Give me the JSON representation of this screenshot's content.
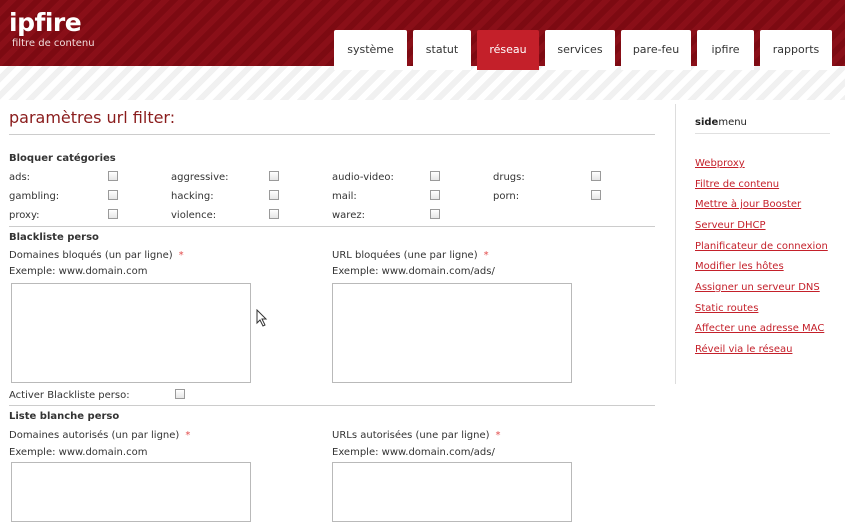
{
  "header": {
    "logo": "ipfire",
    "subtitle": "filtre de contenu",
    "tabs": [
      {
        "label": "système"
      },
      {
        "label": "statut"
      },
      {
        "label": "réseau",
        "active": true
      },
      {
        "label": "services"
      },
      {
        "label": "pare-feu"
      },
      {
        "label": "ipfire"
      },
      {
        "label": "rapports"
      }
    ]
  },
  "main": {
    "title": "paramètres url filter:",
    "block_section": {
      "heading": "Bloquer catégories",
      "categories": [
        {
          "label": "ads:",
          "checked": false
        },
        {
          "label": "aggressive:",
          "checked": false
        },
        {
          "label": "audio-video:",
          "checked": false
        },
        {
          "label": "drugs:",
          "checked": false
        },
        {
          "label": "gambling:",
          "checked": false
        },
        {
          "label": "hacking:",
          "checked": false
        },
        {
          "label": "mail:",
          "checked": false
        },
        {
          "label": "porn:",
          "checked": false
        },
        {
          "label": "proxy:",
          "checked": false
        },
        {
          "label": "violence:",
          "checked": false
        },
        {
          "label": "warez:",
          "checked": false
        }
      ]
    },
    "blacklist": {
      "heading": "Blackliste perso",
      "domains_label": "Domaines bloqués (un par ligne)",
      "domains_example": "Exemple: www.domain.com",
      "urls_label": "URL bloquées (une par ligne)",
      "urls_example": "Exemple: www.domain.com/ads/",
      "domains_value": "",
      "urls_value": "",
      "activate_label": "Activer Blackliste perso:",
      "activate_checked": false
    },
    "whitelist": {
      "heading": "Liste blanche perso",
      "domains_label": "Domaines autorisés (un par ligne)",
      "domains_example": "Exemple: www.domain.com",
      "urls_label": "URLs autorisées (une par ligne)",
      "urls_example": "Exemple: www.domain.com/ads/",
      "domains_value": "",
      "urls_value": ""
    },
    "required_mark": "*"
  },
  "sidemenu": {
    "title_bold": "side",
    "title_rest": "menu",
    "links": [
      "Webproxy",
      "Filtre de contenu",
      "Mettre à jour Booster",
      "Serveur DHCP",
      "Planificateur de connexion",
      "Modifier les hôtes",
      "Assigner un serveur DNS",
      "Static routes",
      "Affecter une adresse MAC",
      "Réveil via le réseau"
    ]
  },
  "colors": {
    "brand": "#7d0a12",
    "active_tab": "#c4202a",
    "link": "#c4202a",
    "title": "#8a1c1c"
  }
}
